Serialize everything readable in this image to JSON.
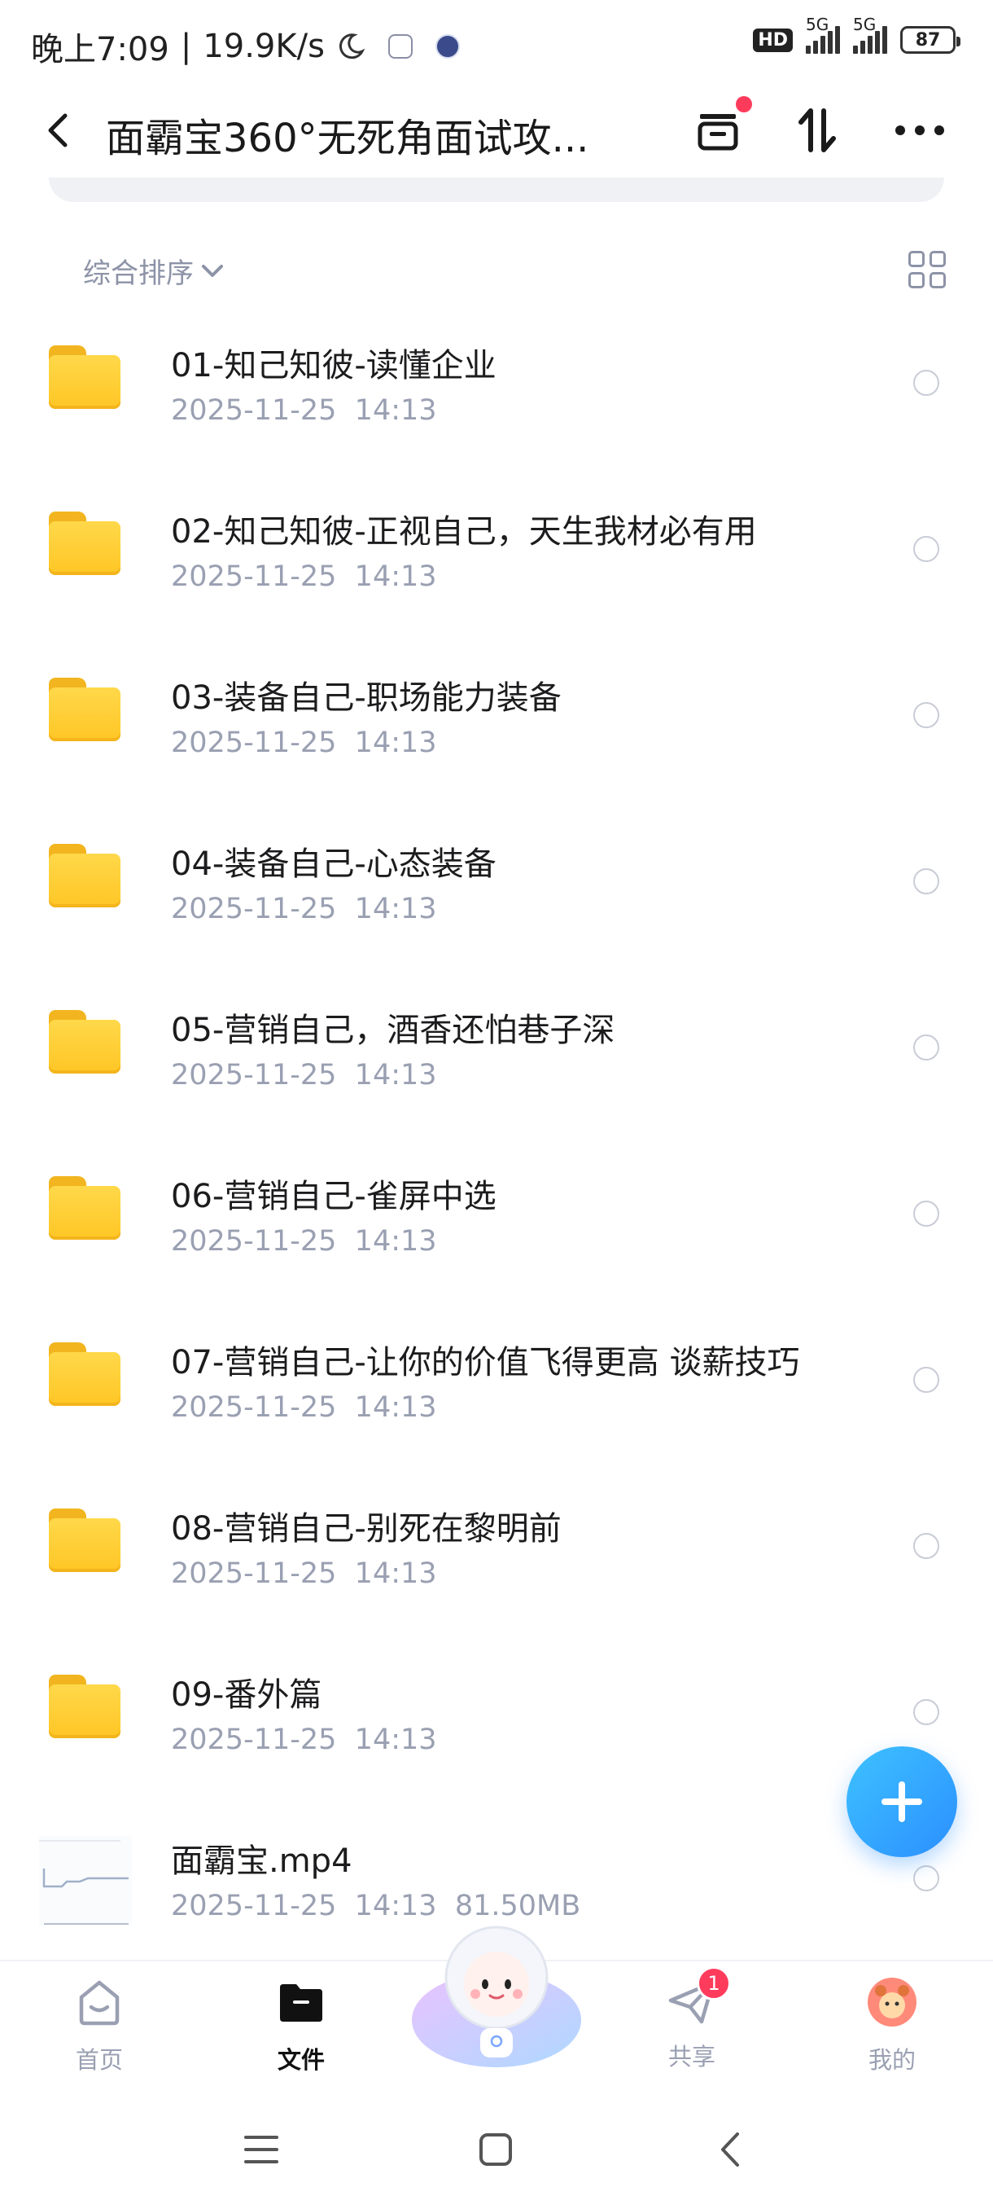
{
  "status_bar": {
    "time": "晚上7:09",
    "net_speed": "19.9K/s",
    "hd_label": "HD",
    "signal1_label": "5G",
    "signal2_label": "5G",
    "battery": "87"
  },
  "header": {
    "title": "面霸宝360°无死角面试攻...",
    "icons": [
      "back-icon",
      "archive-icon",
      "sort-icon",
      "more-icon"
    ]
  },
  "toolbar": {
    "sort_label": "综合排序"
  },
  "files": [
    {
      "name": "01-知己知彼-读懂企业",
      "date": "2025-11-25",
      "time": "14:13",
      "type": "folder"
    },
    {
      "name": "02-知己知彼-正视自己，天生我材必有用",
      "date": "2025-11-25",
      "time": "14:13",
      "type": "folder"
    },
    {
      "name": "03-装备自己-职场能力装备",
      "date": "2025-11-25",
      "time": "14:13",
      "type": "folder"
    },
    {
      "name": "04-装备自己-心态装备",
      "date": "2025-11-25",
      "time": "14:13",
      "type": "folder"
    },
    {
      "name": "05-营销自己，酒香还怕巷子深",
      "date": "2025-11-25",
      "time": "14:13",
      "type": "folder"
    },
    {
      "name": "06-营销自己-雀屏中选",
      "date": "2025-11-25",
      "time": "14:13",
      "type": "folder"
    },
    {
      "name": "07-营销自己-让你的价值飞得更高 谈薪技巧",
      "date": "2025-11-25",
      "time": "14:13",
      "type": "folder"
    },
    {
      "name": "08-营销自己-别死在黎明前",
      "date": "2025-11-25",
      "time": "14:13",
      "type": "folder"
    },
    {
      "name": "09-番外篇",
      "date": "2025-11-25",
      "time": "14:13",
      "type": "folder"
    },
    {
      "name": "面霸宝.mp4",
      "date": "2025-11-25",
      "time": "14:13",
      "size": "81.50MB",
      "type": "video"
    }
  ],
  "bottom_nav": {
    "home": "首页",
    "files": "文件",
    "share": "共享",
    "share_badge": "1",
    "mine": "我的"
  },
  "colors": {
    "accent": "#2b8fff",
    "folder": "#ffc625",
    "badge": "#ff3b5c"
  }
}
